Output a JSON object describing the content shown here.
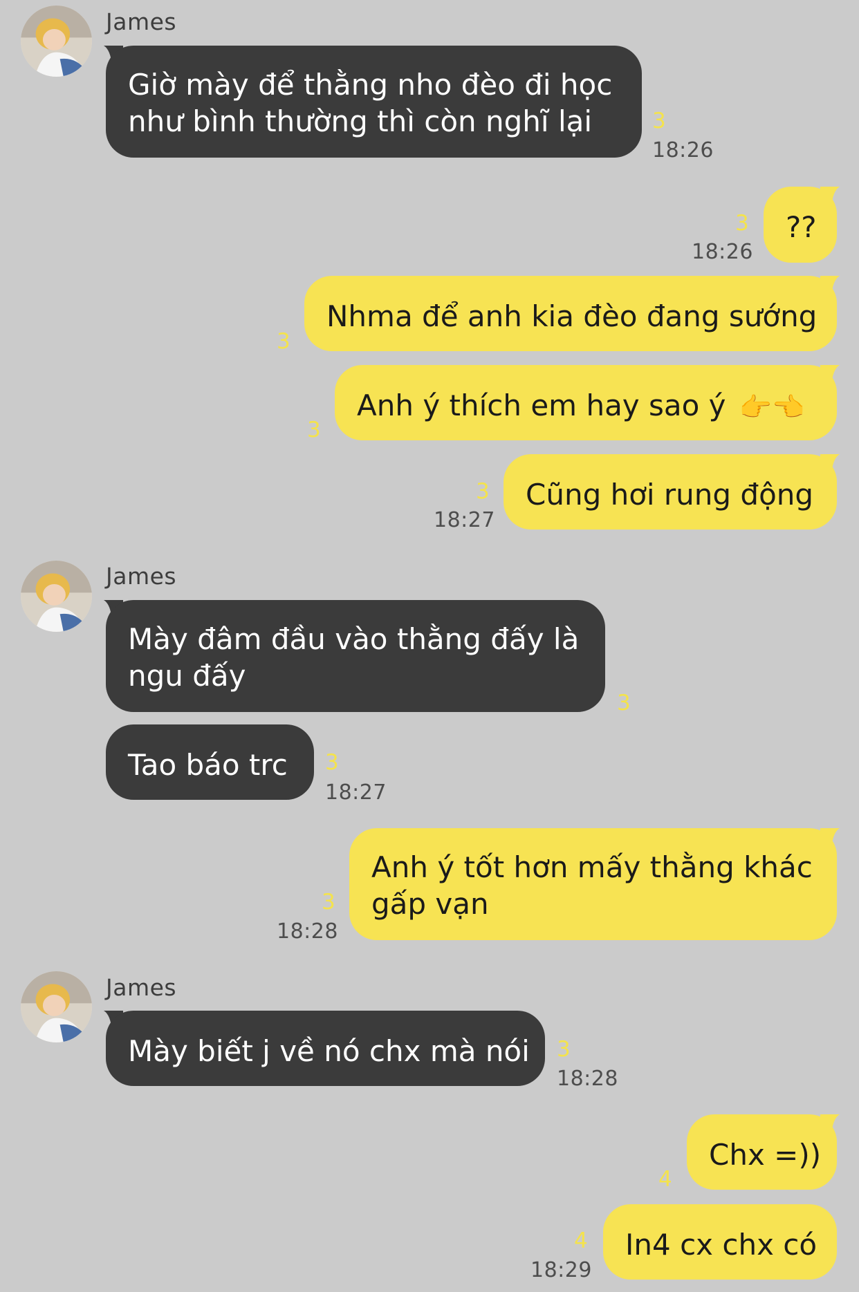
{
  "sender_name": "James",
  "messages": [
    {
      "text_lines": [
        "Giờ mày để thằng nho đèo đi học",
        "như bình thường thì còn nghĩ lại"
      ],
      "unread": "3",
      "time": "18:26"
    },
    {
      "text": "??",
      "unread": "3",
      "time": "18:26"
    },
    {
      "text": "Nhma để anh kia đèo đang sướng",
      "unread": "3"
    },
    {
      "text": "Anh ý thích em hay sao ý",
      "emoji": "👉👈",
      "unread": "3"
    },
    {
      "text": "Cũng hơi rung động",
      "unread": "3",
      "time": "18:27"
    },
    {
      "text_lines": [
        "Mày đâm đầu vào thằng đấy là",
        "ngu đấy"
      ],
      "unread": "3"
    },
    {
      "text": "Tao báo trc",
      "unread": "3",
      "time": "18:27"
    },
    {
      "text_lines": [
        "Anh ý tốt hơn mấy thằng khác",
        "gấp vạn"
      ],
      "unread": "3",
      "time": "18:28"
    },
    {
      "text": "Mày biết j về nó chx mà nói",
      "unread": "3",
      "time": "18:28"
    },
    {
      "text": "Chx =))",
      "unread": "4"
    },
    {
      "text": "In4 cx chx có",
      "unread": "4",
      "time": "18:29"
    }
  ]
}
